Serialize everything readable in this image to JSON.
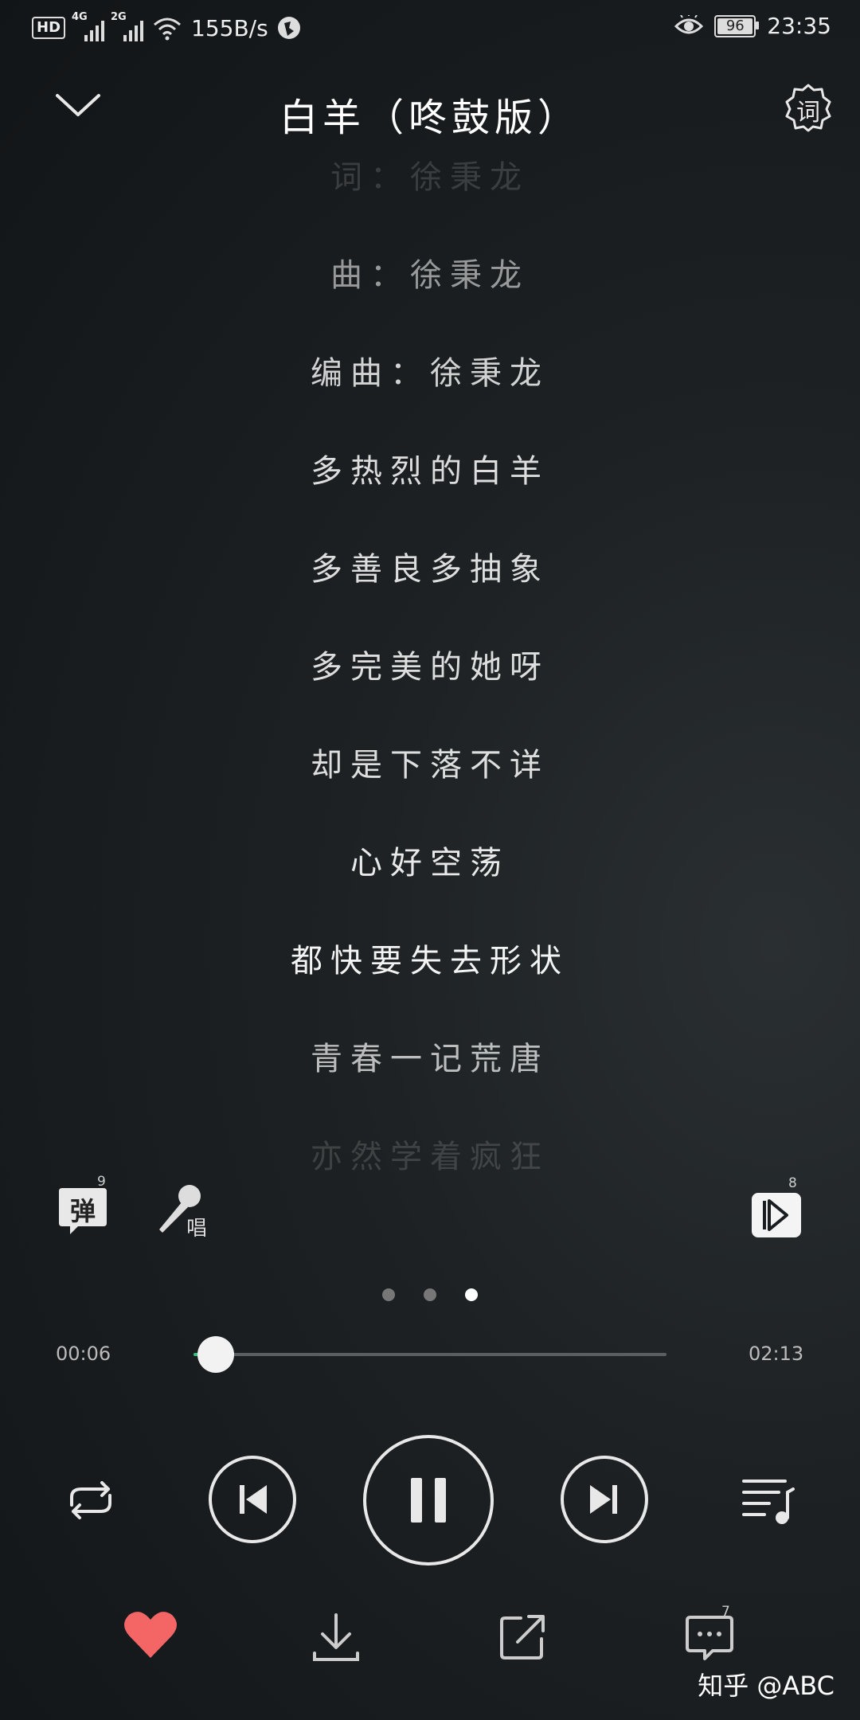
{
  "status_bar": {
    "hd_label": "HD",
    "network_1": "4G",
    "network_2": "2G",
    "speed": "155B/s",
    "battery": "96",
    "time": "23:35"
  },
  "header": {
    "title": "白羊（咚鼓版）",
    "lyrics_button_label": "词"
  },
  "lyrics": [
    {
      "text": "词：徐秉龙",
      "opacity": 0.15
    },
    {
      "text": "曲：徐秉龙",
      "opacity": 0.55
    },
    {
      "text": "编曲：徐秉龙",
      "opacity": 0.8
    },
    {
      "text": "多热烈的白羊",
      "opacity": 0.85
    },
    {
      "text": "多善良多抽象",
      "opacity": 0.85
    },
    {
      "text": "多完美的她呀",
      "opacity": 0.85
    },
    {
      "text": "却是下落不详",
      "opacity": 0.85
    },
    {
      "text": "心好空荡",
      "opacity": 0.9
    },
    {
      "text": "都快要失去形状",
      "opacity": 0.95
    },
    {
      "text": "青春一记荒唐",
      "opacity": 0.7
    },
    {
      "text": "亦然学着疯狂",
      "opacity": 0.15
    }
  ],
  "actions": {
    "danmu_label": "弹",
    "danmu_count": "9",
    "sing_label": "唱",
    "video_count": "8"
  },
  "pager": {
    "count": 3,
    "active_index": 2
  },
  "progress": {
    "current": "00:06",
    "total": "02:13",
    "fraction": 0.047
  },
  "bottom": {
    "comment_count": "7",
    "watermark": "知乎 @ABC"
  },
  "colors": {
    "accent": "#31c27c",
    "heart": "#f46566"
  }
}
